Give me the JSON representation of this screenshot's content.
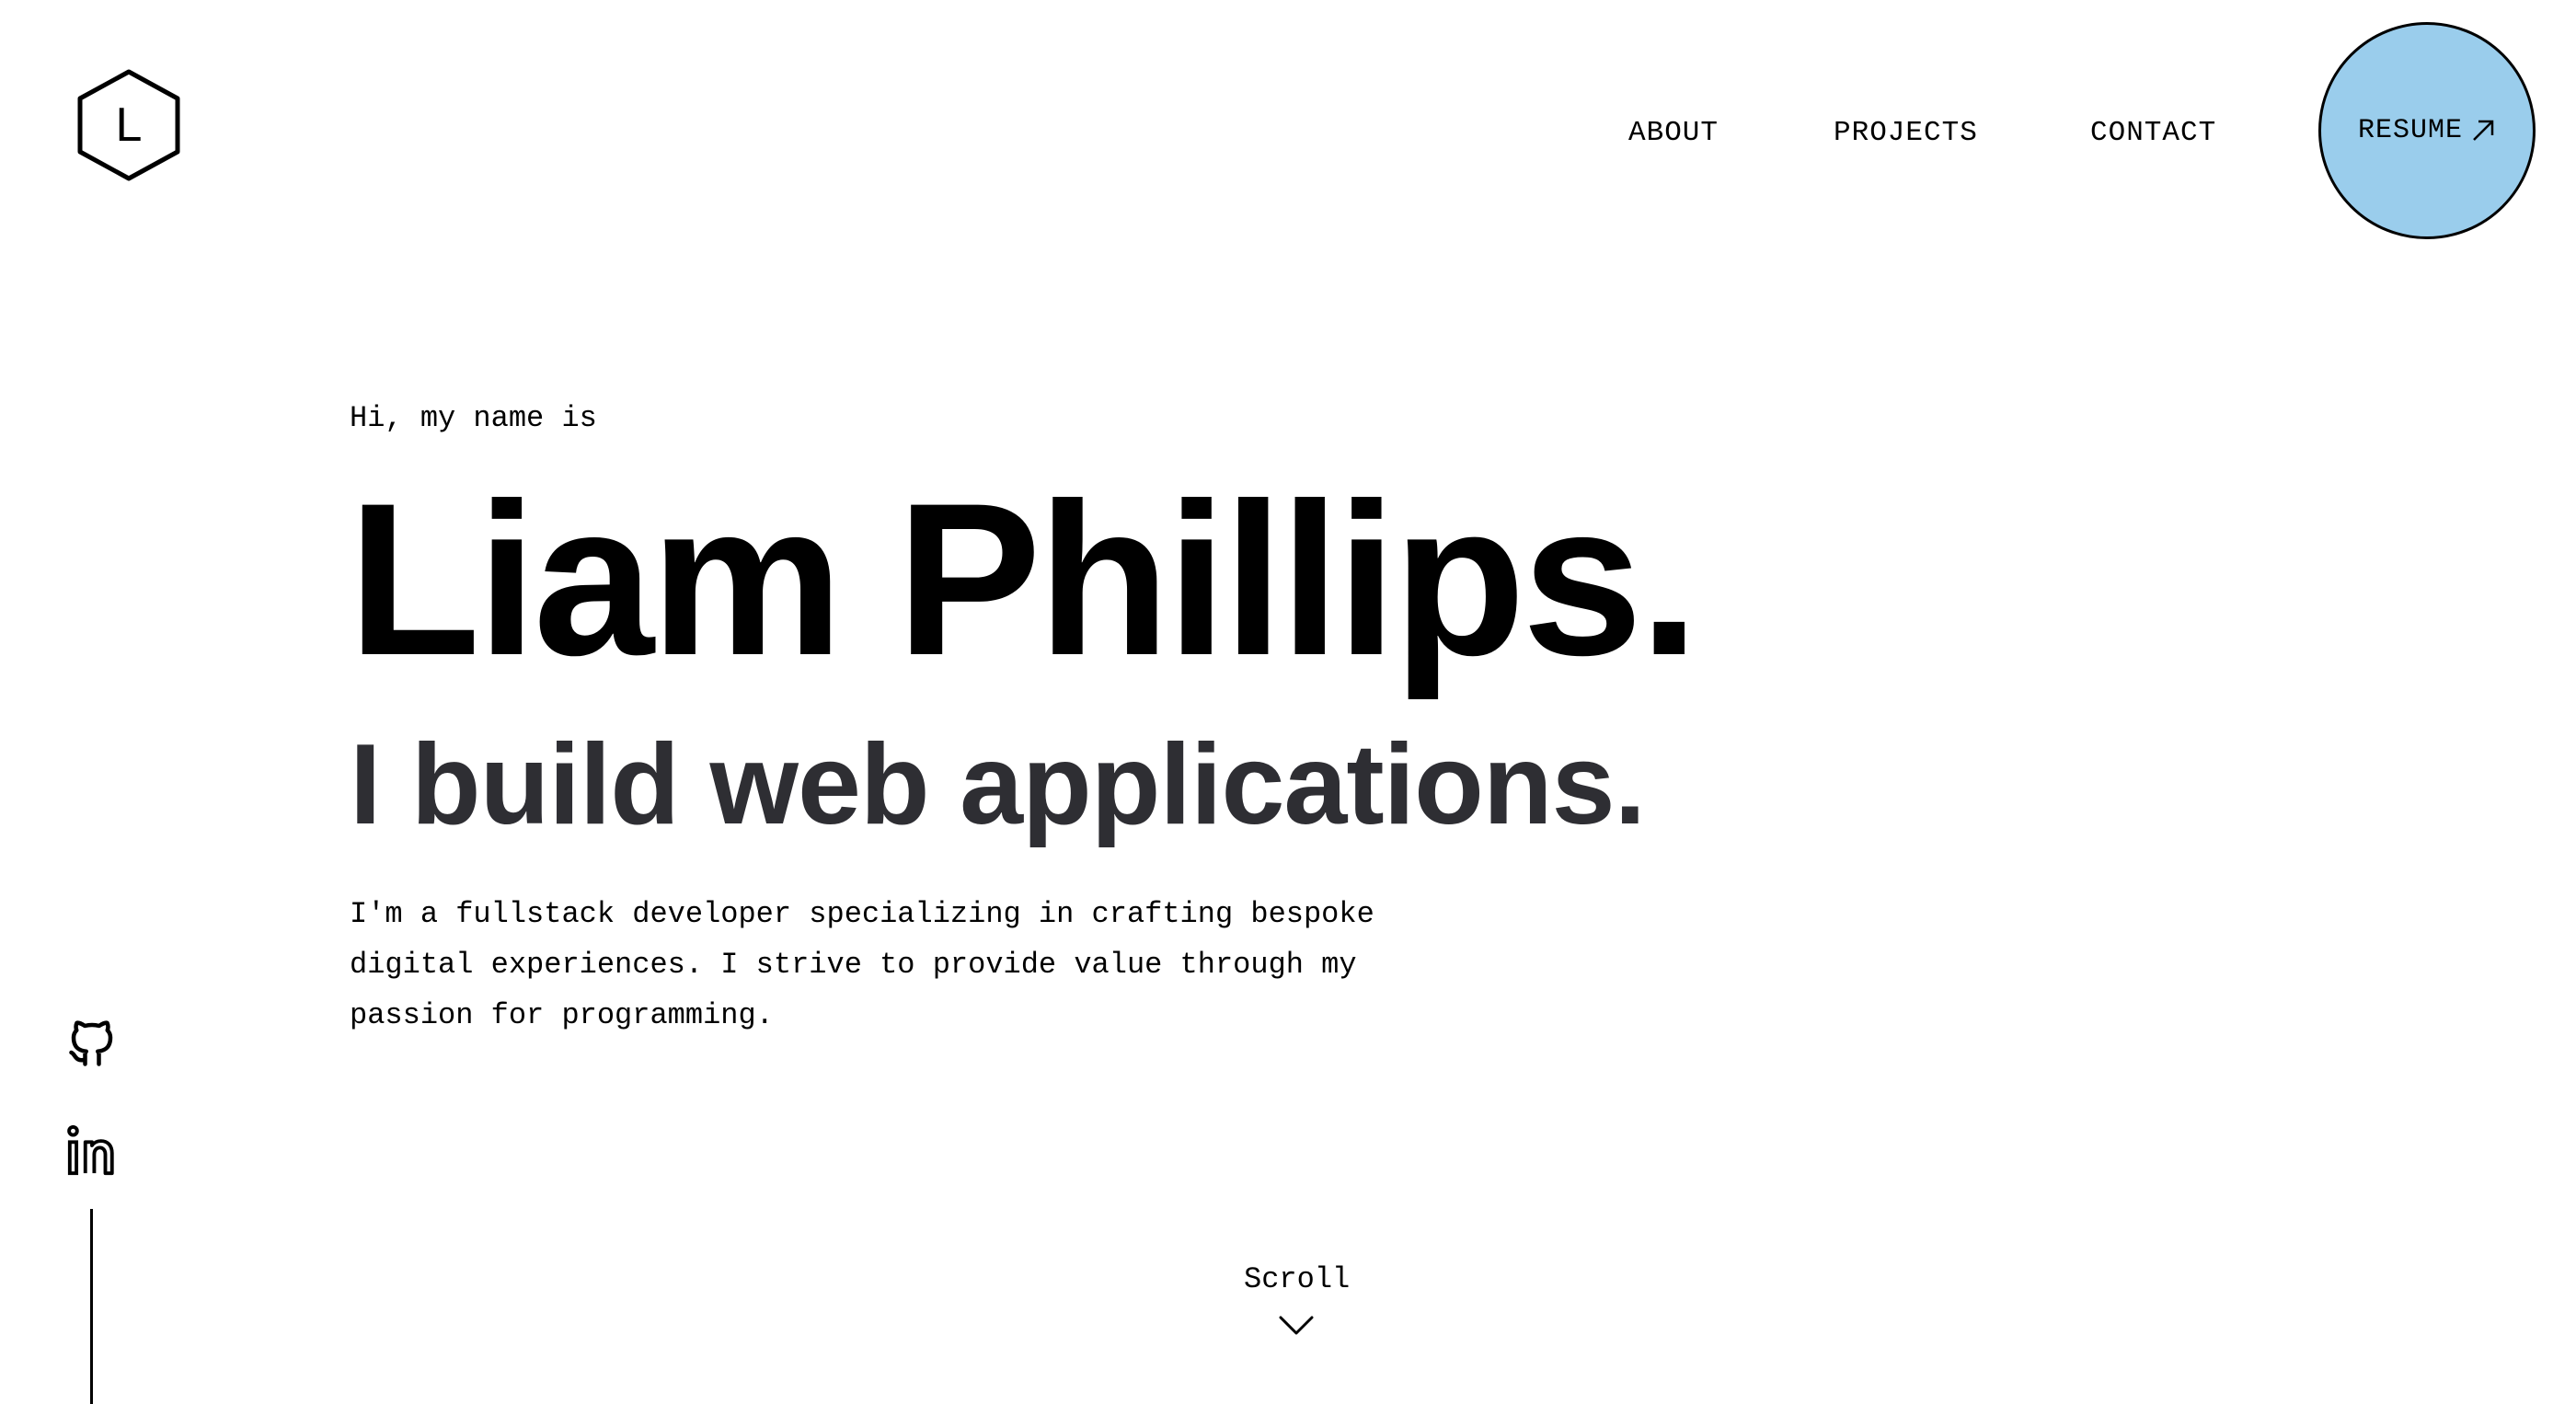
{
  "header": {
    "logo_letter": "L",
    "nav": [
      {
        "label": "ABOUT"
      },
      {
        "label": "PROJECTS"
      },
      {
        "label": "CONTACT"
      }
    ],
    "resume": {
      "label": "RESUME",
      "icon": "arrow-up-right-icon",
      "background": "#9acdec"
    }
  },
  "hero": {
    "greeting": "Hi, my name is",
    "name": "Liam Phillips.",
    "tagline": "I build web applications.",
    "bio": "I'm a fullstack developer specializing in crafting bespoke digital experiences. I strive to provide value through my passion for programming."
  },
  "social": [
    {
      "icon": "github-icon"
    },
    {
      "icon": "linkedin-icon"
    }
  ],
  "scroll": {
    "label": "Scroll",
    "icon": "chevron-down-icon"
  },
  "colors": {
    "accent": "#9acdec",
    "tagline": "#2e2e33",
    "text": "#000000",
    "background": "#ffffff"
  }
}
